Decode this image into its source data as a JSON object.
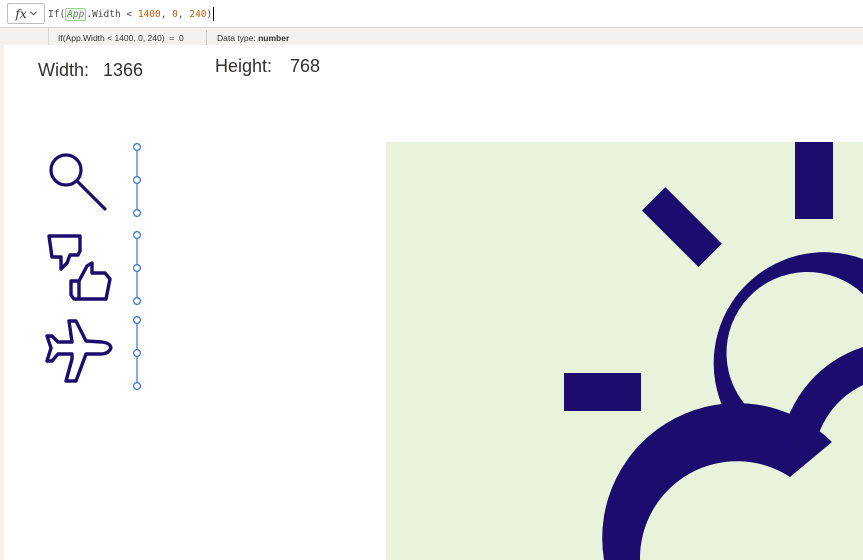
{
  "formula_bar": {
    "fx_label": "fx",
    "formula": {
      "fn": "If(",
      "app": "App",
      "rest": ".Width < ",
      "num1": "1400",
      "sep1": ", ",
      "num2": "0",
      "sep2": ", ",
      "num3": "240",
      "close": ")"
    }
  },
  "result_bar": {
    "expression": "If(App.Width < 1400, 0, 240)  =  0",
    "type_label": "Data type: ",
    "type_value": "number"
  },
  "canvas": {
    "width_label": "Width:",
    "width_value": "1366",
    "height_label": "Height:",
    "height_value": "768"
  },
  "icons": {
    "search": "search-icon",
    "feedback": "thumbs-up-down-icon",
    "airplane": "airplane-icon",
    "weather": "partly-sunny-icon"
  },
  "colors": {
    "icon": "#1b0c6e",
    "image_bg": "#e9f3dc",
    "selection": "#3a6fd6",
    "number_token": "#c25d12"
  }
}
